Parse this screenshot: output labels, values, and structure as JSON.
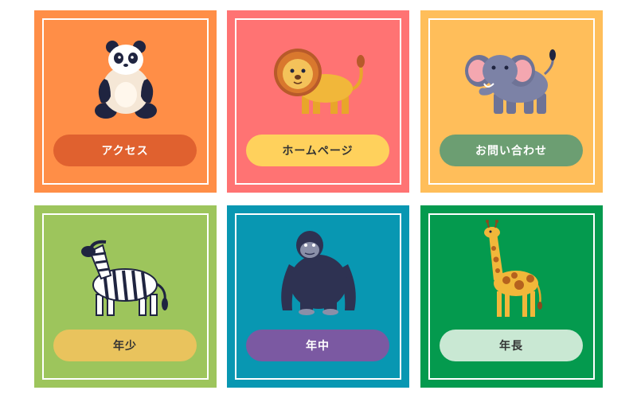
{
  "cards": [
    {
      "id": "access",
      "label": "アクセス",
      "icon": "panda-icon",
      "bg": "#FF8E47",
      "button_bg": "#E0612F",
      "button_fg": "#FFFFFF"
    },
    {
      "id": "homepage",
      "label": "ホームページ",
      "icon": "lion-icon",
      "bg": "#FF7373",
      "button_bg": "#FFD15C",
      "button_fg": "#333333"
    },
    {
      "id": "contact",
      "label": "お問い合わせ",
      "icon": "elephant-icon",
      "bg": "#FFBE5A",
      "button_bg": "#6C9E72",
      "button_fg": "#FFFFFF"
    },
    {
      "id": "nensho",
      "label": "年少",
      "icon": "zebra-icon",
      "bg": "#9DC55C",
      "button_bg": "#E9C35D",
      "button_fg": "#333333"
    },
    {
      "id": "nenchu",
      "label": "年中",
      "icon": "gorilla-icon",
      "bg": "#0897B2",
      "button_bg": "#7B59A2",
      "button_fg": "#FFFFFF"
    },
    {
      "id": "nencho",
      "label": "年長",
      "icon": "giraffe-icon",
      "bg": "#049A4E",
      "button_bg": "#C9E8D3",
      "button_fg": "#333333"
    }
  ]
}
